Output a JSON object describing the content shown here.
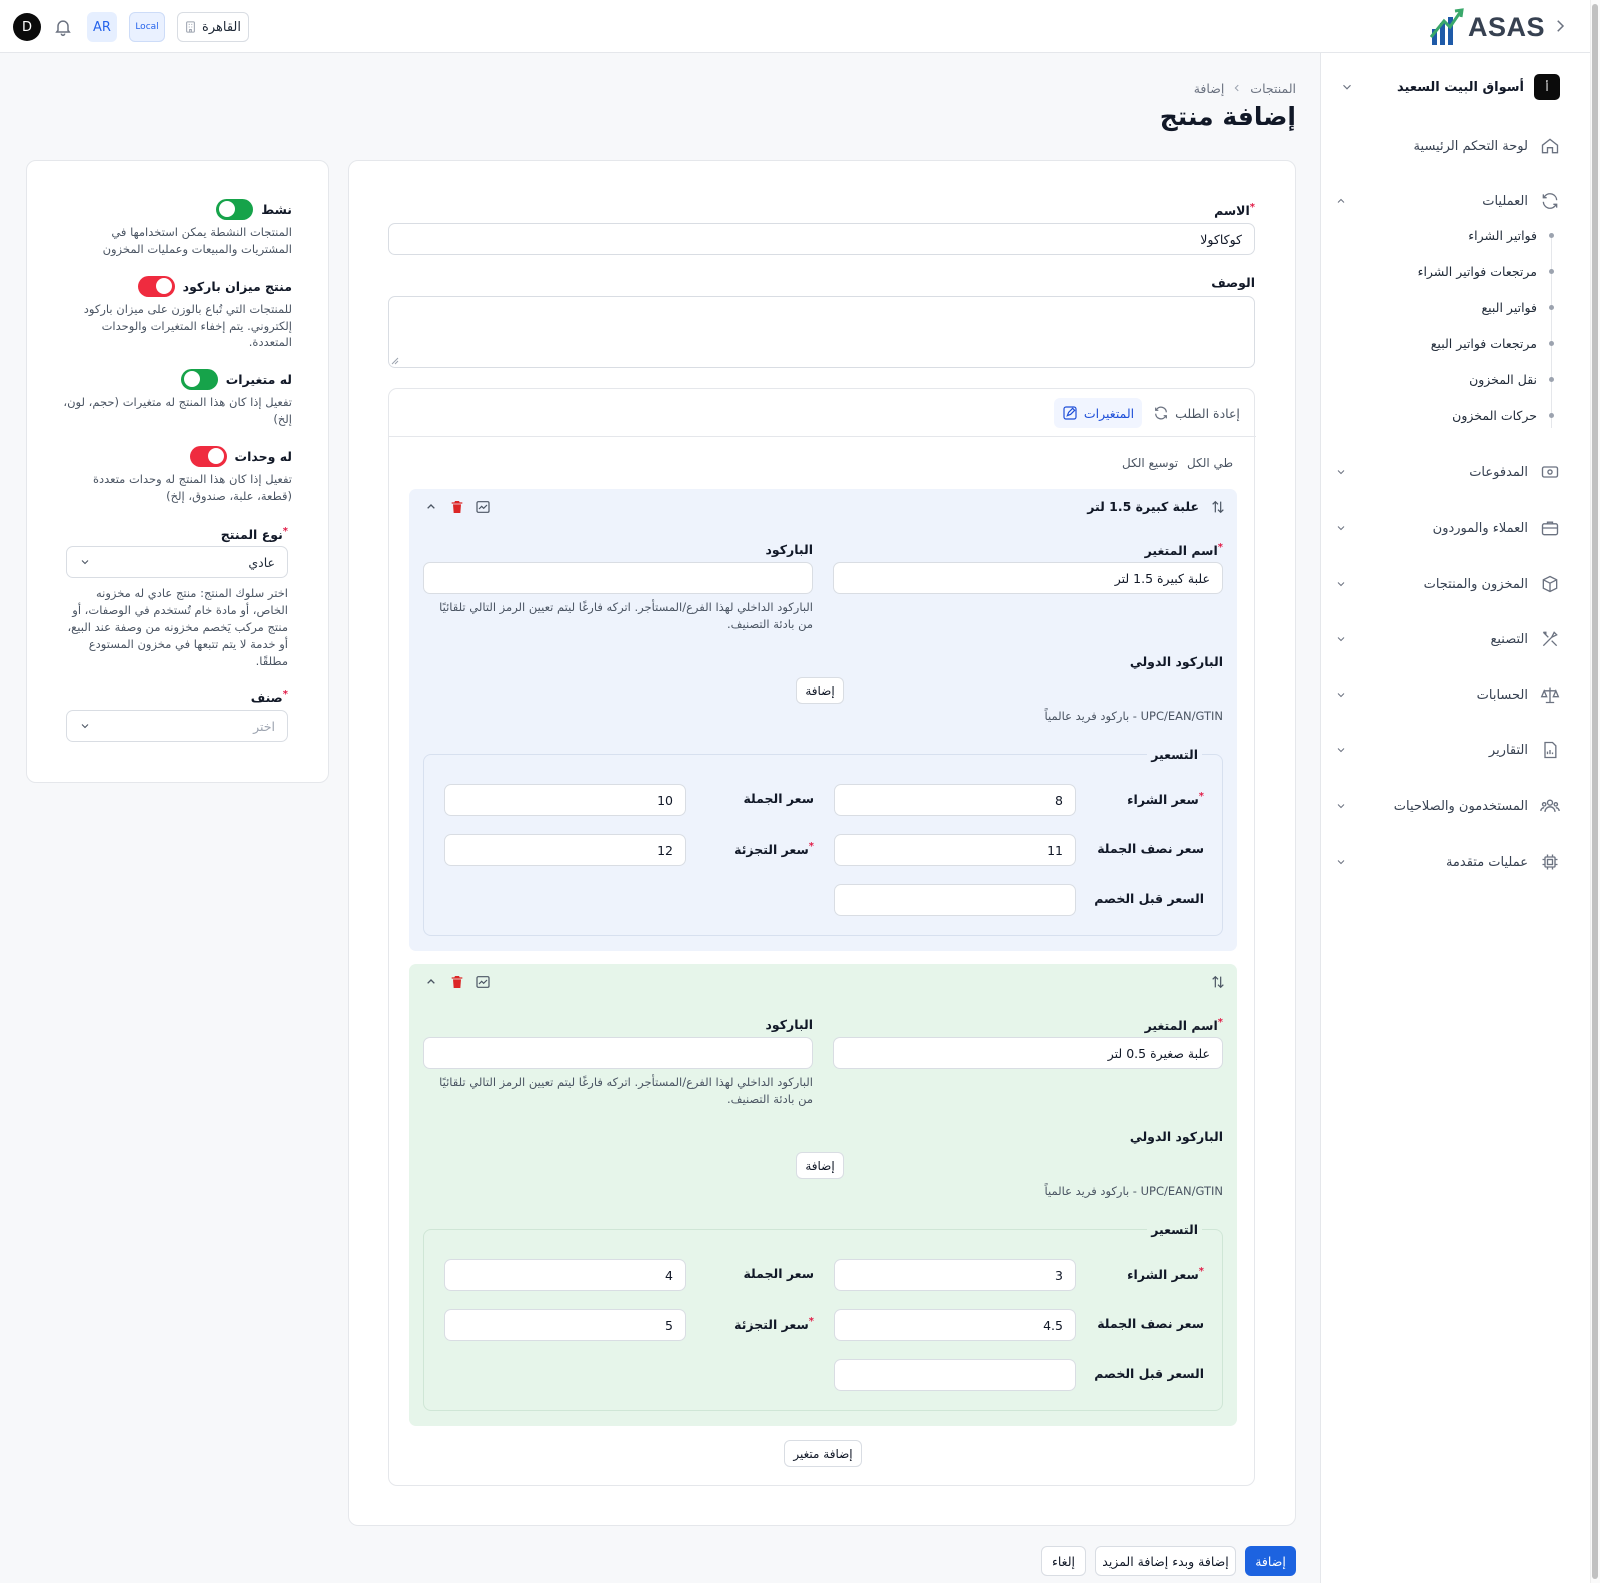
{
  "topbar": {
    "user_initial": "D",
    "lang": "AR",
    "env": "Local",
    "branch": "القاهرة",
    "logo_text": "ASAS"
  },
  "sidebar": {
    "company": {
      "badge": "أ",
      "name": "أسواق البيت السعيد"
    },
    "items": [
      {
        "label": "لوحة التحكم الرئيسية",
        "icon": "home-icon"
      },
      {
        "label": "العمليات",
        "icon": "refresh-icon",
        "expanded": true
      },
      {
        "label": "المدفوعات",
        "icon": "money-icon"
      },
      {
        "label": "العملاء والموردون",
        "icon": "briefcase-icon"
      },
      {
        "label": "المخزون والمنتجات",
        "icon": "box-icon"
      },
      {
        "label": "التصنيع",
        "icon": "tools-icon"
      },
      {
        "label": "الحسابات",
        "icon": "scale-icon"
      },
      {
        "label": "التقارير",
        "icon": "report-icon"
      },
      {
        "label": "المستخدمون والصلاحيات",
        "icon": "users-icon"
      },
      {
        "label": "عمليات متقدمة",
        "icon": "chip-icon"
      }
    ],
    "operations_sub": [
      "فواتير الشراء",
      "مرتجعات فواتير الشراء",
      "فواتير البيع",
      "مرتجعات فواتير البيع",
      "نقل المخزون",
      "حركات المخزون"
    ]
  },
  "breadcrumb": {
    "parent": "المنتجات",
    "current": "إضافة"
  },
  "page_title": "إضافة منتج",
  "form": {
    "name_label": "الاسم",
    "name_value": "كوكاكولا",
    "desc_label": "الوصف",
    "desc_value": ""
  },
  "variants_section": {
    "tab_variants": "المتغيرات",
    "tab_reorder": "إعادة الطلب",
    "collapse_all": "طي الكل",
    "expand_all": "توسيع الكل",
    "add_variant": "إضافة متغير",
    "labels": {
      "variant_name": "اسم المتغير",
      "barcode": "الباركود",
      "barcode_hint": "الباركود الداخلي لهذا الفرع/المستأجر. اتركه فارغًا ليتم تعيين الرمز التالي تلقائيًا من بادئة التصنيف.",
      "intl_barcode": "الباركود الدولي",
      "add": "إضافة",
      "intl_hint": "UPC/EAN/GTIN - باركود فريد عالمياً",
      "pricing": "التسعير",
      "purchase_price": "سعر الشراء",
      "wholesale_price": "سعر الجملة",
      "half_wholesale_price": "سعر نصف الجملة",
      "retail_price": "سعر التجزئة",
      "pre_discount_price": "السعر قبل الخصم"
    },
    "variants": [
      {
        "title": "علبة كبيرة 1.5 لتر",
        "name": "علبة كبيرة 1.5 لتر",
        "barcode": "",
        "purchase_price": "8",
        "wholesale_price": "10",
        "half_wholesale_price": "11",
        "retail_price": "12",
        "pre_discount_price": ""
      },
      {
        "title": "",
        "name": "علبة صغيرة 0.5 لتر",
        "barcode": "",
        "purchase_price": "3",
        "wholesale_price": "4",
        "half_wholesale_price": "4.5",
        "retail_price": "5",
        "pre_discount_price": ""
      }
    ]
  },
  "settings": {
    "active": {
      "label": "نشط",
      "on": true,
      "desc": "المنتجات النشطة يمكن استخدامها في المشتريات والمبيعات وعمليات المخزون"
    },
    "scale": {
      "label": "منتج ميزان باركود",
      "on": false,
      "desc": "للمنتجات التي تُباع بالوزن على ميزان باركود إلكتروني. يتم إخفاء المتغيرات والوحدات المتعددة."
    },
    "has_variants": {
      "label": "له متغيرات",
      "on": true,
      "desc": "تفعيل إذا كان هذا المنتج له متغيرات (حجم، لون، إلخ)"
    },
    "has_units": {
      "label": "له وحدات",
      "on": false,
      "desc": "تفعيل إذا كان هذا المنتج له وحدات متعددة (قطعة، علبة، صندوق، إلخ)"
    },
    "product_type_label": "نوع المنتج",
    "product_type_value": "عادي",
    "product_type_desc": "اختر سلوك المنتج: منتج عادي له مخزونه الخاص، أو مادة خام تُستخدم في الوصفات، أو منتج مركب يَخصم مخزونه من وصفة عند البيع، أو خدمة لا يتم تتبعها في مخزون المستودع مطلقًا.",
    "category_label": "صنف",
    "category_placeholder": "اختر"
  },
  "footer": {
    "add": "إضافة",
    "add_and_more": "إضافة وبدء إضافة المزيد",
    "cancel": "إلغاء"
  },
  "colors": {
    "primary": "#1d63e0",
    "toggle_on": "#16a34a",
    "toggle_off": "#ef2b3f",
    "variant_1_bg": "#eef3fc",
    "variant_2_bg": "#e6f5ea",
    "required": "#e11d48"
  }
}
